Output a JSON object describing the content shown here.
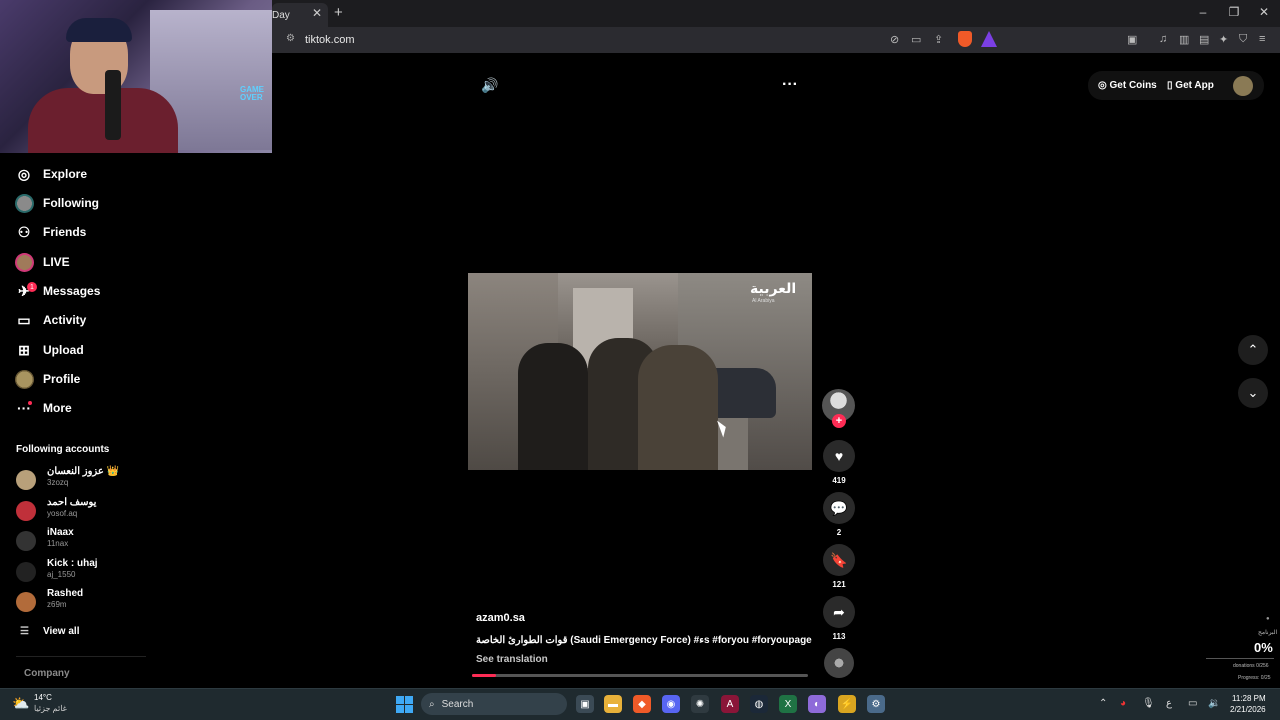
{
  "browser": {
    "tab_title": "Day",
    "tab_close": "✕",
    "new_tab": "+",
    "url": "tiktok.com",
    "window_controls": {
      "minimize": "–",
      "restore": "❐",
      "close": "✕"
    }
  },
  "webcam": {
    "overlay_logo": "GAME OVER"
  },
  "sidebar": {
    "nav": [
      {
        "label": "Explore",
        "icon": "compass-icon",
        "glyph": "◎"
      },
      {
        "label": "Following",
        "icon": "following-avatar",
        "glyph": ""
      },
      {
        "label": "Friends",
        "icon": "friends-icon",
        "glyph": "👥"
      },
      {
        "label": "LIVE",
        "icon": "live-avatar",
        "glyph": ""
      },
      {
        "label": "Messages",
        "icon": "messages-icon",
        "glyph": "✈"
      },
      {
        "label": "Activity",
        "icon": "activity-icon",
        "glyph": "▭"
      },
      {
        "label": "Upload",
        "icon": "upload-icon",
        "glyph": "⊞"
      },
      {
        "label": "Profile",
        "icon": "profile-avatar",
        "glyph": ""
      },
      {
        "label": "More",
        "icon": "more-icon",
        "glyph": "···"
      }
    ],
    "messages_badge": "1",
    "following_heading": "Following accounts",
    "accounts": [
      {
        "name": "عزوز النعسان 👑",
        "handle": "3zozq",
        "color": "#b8a07a"
      },
      {
        "name": "يوسف احمد",
        "handle": "yosof.aq",
        "color": "#c0303a"
      },
      {
        "name": "iNaax",
        "handle": "11nax",
        "color": "#333333"
      },
      {
        "name": "Kick : uhaj",
        "handle": "aj_1550",
        "color": "#222222"
      },
      {
        "name": "Rashed",
        "handle": "z69m",
        "color": "#b26b3a"
      }
    ],
    "view_all": "View all",
    "view_all_icon": "☰",
    "company": "Company"
  },
  "player": {
    "volume_icon": "🔊",
    "more_icon": "···",
    "get_coins": "Get Coins",
    "get_app": "Get App",
    "coins_icon": "◎",
    "app_icon": "▯",
    "watermark": "العربية",
    "watermark_sub": "Al Arabiya",
    "creator": "azam0.sa",
    "caption": "قوات الطوارئ الخاصة (Saudi Emergency Force) #ءs #foryou #foryoupage",
    "see_translation": "See translation",
    "progress": 0.07,
    "follow_plus": "+",
    "actions": [
      {
        "name": "like-button",
        "glyph": "♥",
        "count": "419"
      },
      {
        "name": "comment-button",
        "glyph": "💬",
        "count": "2"
      },
      {
        "name": "bookmark-button",
        "glyph": "🔖",
        "count": "121"
      },
      {
        "name": "share-button",
        "glyph": "➦",
        "count": "113"
      }
    ],
    "nav_up": "⌃",
    "nav_down": "⌄"
  },
  "donation": {
    "label": "البرنامج",
    "percent": "0%",
    "count": "donations 0/256",
    "progress": "Progress: 0/25"
  },
  "taskbar": {
    "weather_temp": "14°C",
    "weather_desc": "غائم جزئيا",
    "search_label": "Search",
    "search_icon": "⌕",
    "tray_lang": "ع",
    "time": "11:28 PM",
    "date": "2/21/2026",
    "apps": [
      {
        "name": "task-view-icon",
        "glyph": "▣",
        "color": "#3b4a55"
      },
      {
        "name": "file-explorer-icon",
        "glyph": "▬",
        "color": "#e8b13a"
      },
      {
        "name": "brave-icon",
        "glyph": "◆",
        "color": "#f05a28"
      },
      {
        "name": "discord-icon",
        "glyph": "◉",
        "color": "#5865f2"
      },
      {
        "name": "chatgpt-icon",
        "glyph": "✺",
        "color": "#2f3a40"
      },
      {
        "name": "affinity-icon",
        "glyph": "A",
        "color": "#8a1538"
      },
      {
        "name": "steam-icon",
        "glyph": "◍",
        "color": "#1b2838"
      },
      {
        "name": "excel-icon",
        "glyph": "X",
        "color": "#1f7244"
      },
      {
        "name": "app-purple-icon",
        "glyph": "◐",
        "color": "#8e6bd9"
      },
      {
        "name": "app-yellow-icon",
        "glyph": "⚡",
        "color": "#d9a520"
      },
      {
        "name": "settings-icon",
        "glyph": "⚙",
        "color": "#4a6a8a"
      }
    ]
  }
}
